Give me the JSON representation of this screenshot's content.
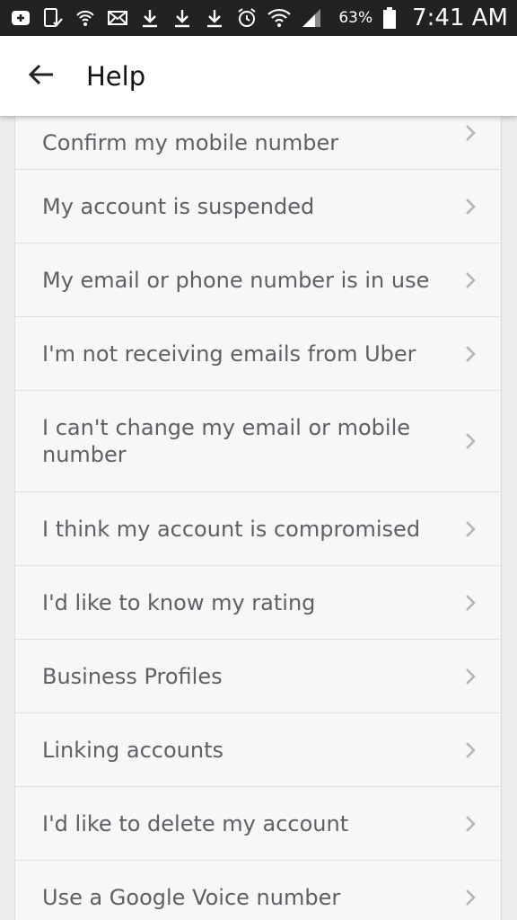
{
  "status_bar": {
    "battery_percent": "63%",
    "time": "7:41 AM",
    "icons": [
      "add-box-icon",
      "tablet-check-icon",
      "wifi-call-icon",
      "mail-icon",
      "download-icon",
      "download-icon",
      "download-icon",
      "alarm-icon",
      "wifi-icon",
      "signal-icon",
      "battery-icon"
    ]
  },
  "header": {
    "title": "Help",
    "back_icon": "arrow-back-icon"
  },
  "list": {
    "items": [
      {
        "label": "Confirm my mobile number"
      },
      {
        "label": "My account is suspended"
      },
      {
        "label": "My email or phone number is in use"
      },
      {
        "label": "I'm not receiving emails from Uber"
      },
      {
        "label": "I can't change my email or mobile number"
      },
      {
        "label": "I think my account is compromised"
      },
      {
        "label": "I'd like to know my rating"
      },
      {
        "label": "Business Profiles"
      },
      {
        "label": "Linking accounts"
      },
      {
        "label": "I'd like to delete my account"
      },
      {
        "label": "Use a Google Voice number"
      }
    ]
  },
  "colors": {
    "status_bar_bg": "#222222",
    "appbar_bg": "#ffffff",
    "list_bg": "#f7f7f8",
    "text": "#5f5f66",
    "chevron": "#b5b5ba"
  }
}
